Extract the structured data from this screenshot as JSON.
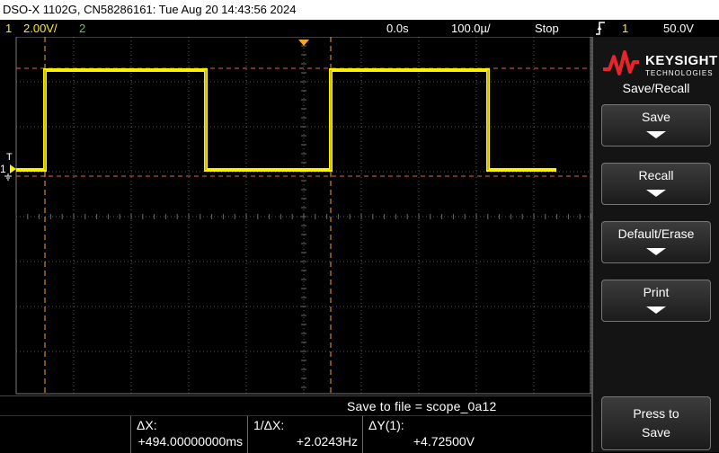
{
  "title_bar": {
    "text": "DSO-X 1102G, CN58286161: Tue Aug 20 14:43:56 2024"
  },
  "status_bar": {
    "ch1_number": "1",
    "ch1_scale": "2.00V/",
    "ch2_number": "2",
    "time_delay": "0.0s",
    "time_scale": "100.0µ/",
    "run_state": "Stop",
    "trigger_icon": "rising-edge-trigger-icon",
    "trigger_source": "1",
    "trigger_level": "50.0V"
  },
  "screen": {
    "ch1_ground_marker": "1",
    "trigger_marker": "T",
    "colors": {
      "trace": "#ffef00",
      "cursor": "#f5a623",
      "grid": "#5a5a5a",
      "trigger_arrow": "#f5a623"
    }
  },
  "save_status": {
    "text": "Save to file = scope_0a12"
  },
  "measurements": {
    "dx_label": "ΔX:",
    "dx_value": "+494.00000000ms",
    "inv_dx_label": "1/ΔX:",
    "inv_dx_value": "+2.0243Hz",
    "dy_label": "ΔY(1):",
    "dy_value": "+4.72500V"
  },
  "side_panel": {
    "brand": "KEYSIGHT",
    "brand_sub": "TECHNOLOGIES",
    "menu_title": "Save/Recall",
    "softkeys": [
      {
        "label": "Save"
      },
      {
        "label": "Recall"
      },
      {
        "label": "Default/Erase"
      },
      {
        "label": "Print"
      }
    ],
    "press_to_save": {
      "line1": "Press to",
      "line2": "Save"
    }
  }
}
